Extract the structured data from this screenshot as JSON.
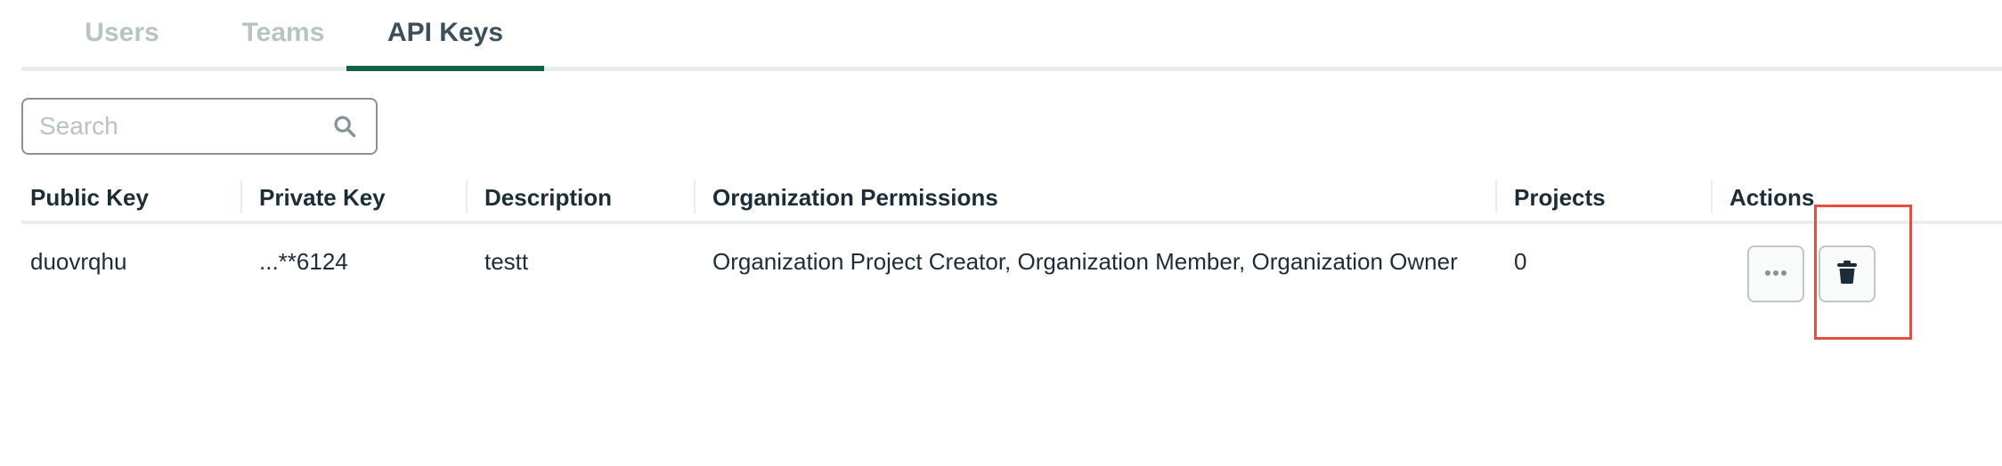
{
  "tabs": [
    {
      "label": "Users"
    },
    {
      "label": "Teams"
    },
    {
      "label": "API Keys"
    }
  ],
  "active_tab": "API Keys",
  "search": {
    "placeholder": "Search",
    "value": ""
  },
  "table": {
    "headers": [
      "Public Key",
      "Private Key",
      "Description",
      "Organization Permissions",
      "Projects",
      "Actions"
    ],
    "rows": [
      {
        "public_key": "duovrqhu",
        "private_key": "...**6124",
        "description": "testt",
        "permissions": "Organization Project Creator, Organization Member, Organization Owner",
        "projects": "0"
      }
    ]
  },
  "icons": {
    "search": "search-icon",
    "more": "ellipsis-icon",
    "delete": "trash-icon"
  },
  "colors": {
    "active_tab_underline": "#116149",
    "highlight": "#e74c3c"
  }
}
